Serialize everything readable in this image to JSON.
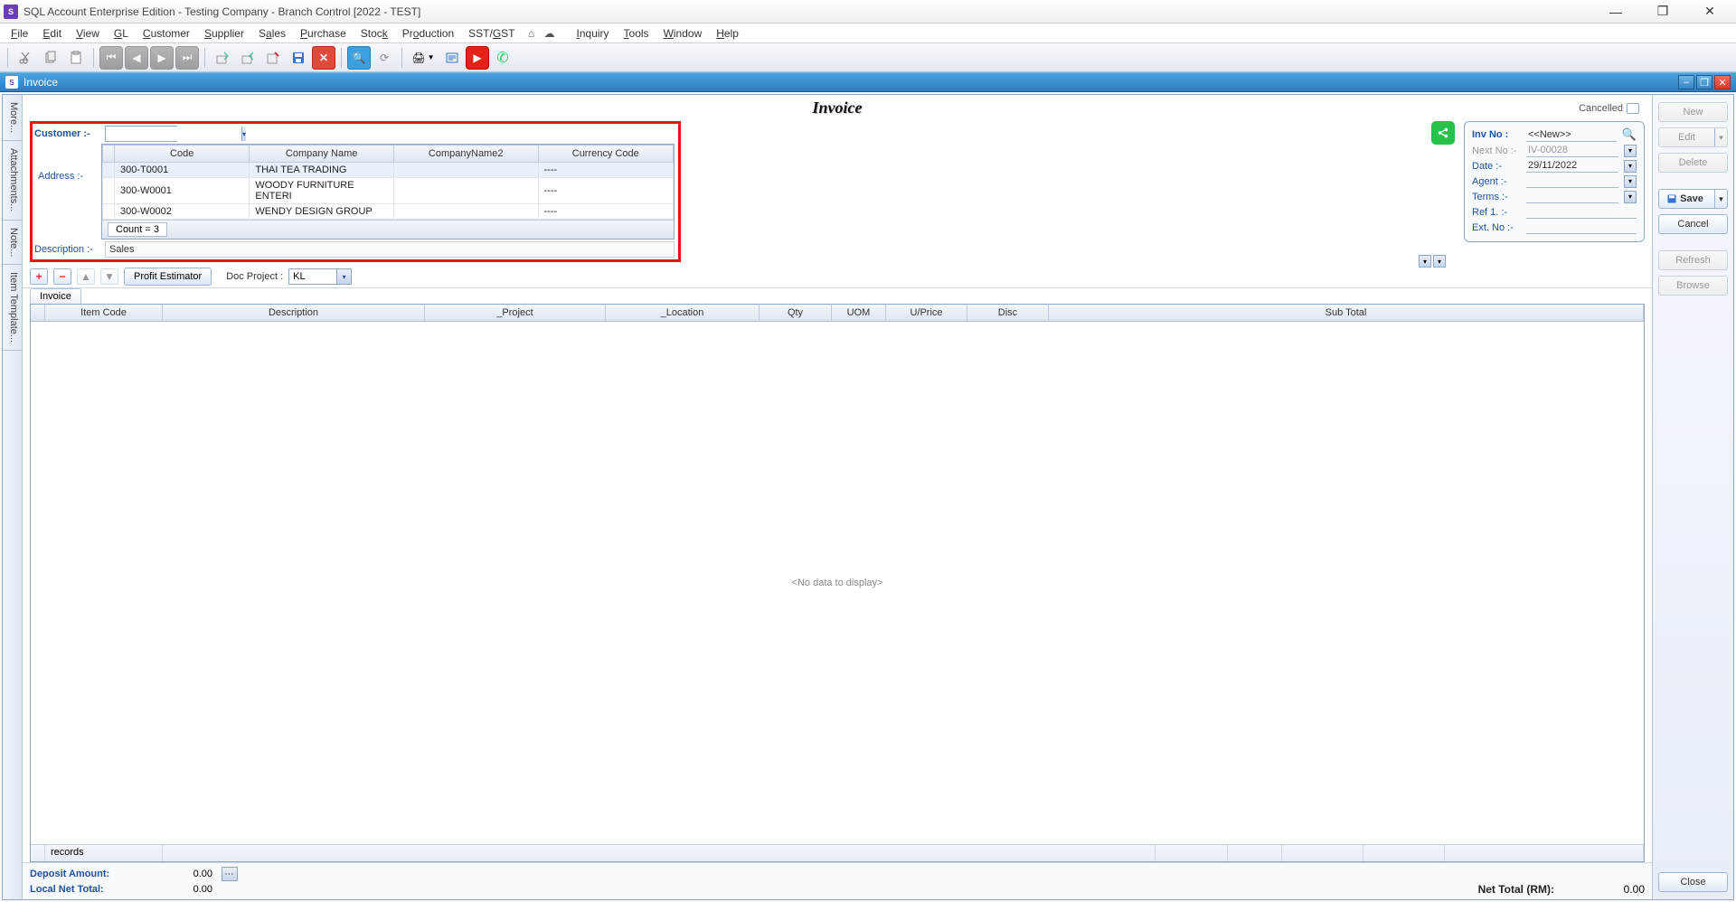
{
  "app": {
    "title": "SQL Account Enterprise Edition - Testing Company - Branch Control [2022 - TEST]"
  },
  "menu": [
    "File",
    "Edit",
    "View",
    "GL",
    "Customer",
    "Supplier",
    "Sales",
    "Purchase",
    "Stock",
    "Production",
    "SST/GST",
    "",
    "",
    "",
    "Inquiry",
    "Tools",
    "Window",
    "Help"
  ],
  "subwindow": {
    "title": "Invoice"
  },
  "side_tabs": [
    "More...",
    "Attachments...",
    "Note...",
    "Item Template..."
  ],
  "doc": {
    "title": "Invoice"
  },
  "customer": {
    "label": "Customer :-",
    "address_label": "Address :-",
    "description_label": "Description :-",
    "description_value": "Sales",
    "dropdown": {
      "headers": [
        "Code",
        "Company Name",
        "CompanyName2",
        "Currency Code"
      ],
      "rows": [
        {
          "code": "300-T0001",
          "name": "THAI TEA TRADING",
          "name2": "",
          "cur": "----"
        },
        {
          "code": "300-W0001",
          "name": "WOODY FURNITURE ENTERI",
          "name2": "",
          "cur": "----"
        },
        {
          "code": "300-W0002",
          "name": "WENDY DESIGN GROUP",
          "name2": "",
          "cur": "----"
        }
      ],
      "count_label": "Count = 3"
    }
  },
  "info": {
    "cancelled_label": "Cancelled",
    "rows": {
      "inv_no": {
        "label": "Inv No :",
        "value": "<<New>>"
      },
      "next_no": {
        "label": "Next No :-",
        "value": "IV-00028"
      },
      "date": {
        "label": "Date :-",
        "value": "29/11/2022"
      },
      "agent": {
        "label": "Agent :-",
        "value": ""
      },
      "terms": {
        "label": "Terms :-",
        "value": ""
      },
      "ref1": {
        "label": "Ref 1. :-",
        "value": ""
      },
      "ext_no": {
        "label": "Ext. No :-",
        "value": ""
      }
    }
  },
  "actions": {
    "profit_estimator": "Profit Estimator",
    "doc_project_label": "Doc Project :",
    "doc_project_value": "KL"
  },
  "tabs": [
    "Invoice"
  ],
  "grid": {
    "columns": [
      "",
      "Item Code",
      "Description",
      "_Project",
      "_Location",
      "Qty",
      "UOM",
      "U/Price",
      "Disc",
      "Sub Total"
    ],
    "widths": [
      16,
      130,
      290,
      200,
      170,
      80,
      60,
      90,
      90,
      220
    ],
    "empty_text": "<No data to display>",
    "footer_records": "records"
  },
  "bottom": {
    "deposit_label": "Deposit Amount:",
    "deposit_value": "0.00",
    "local_net_label": "Local Net Total:",
    "local_net_value": "0.00",
    "net_total_label": "Net Total (RM):",
    "net_total_value": "0.00"
  },
  "right_buttons": {
    "new": "New",
    "edit": "Edit",
    "delete": "Delete",
    "save": "Save",
    "cancel": "Cancel",
    "refresh": "Refresh",
    "browse": "Browse",
    "close": "Close"
  }
}
